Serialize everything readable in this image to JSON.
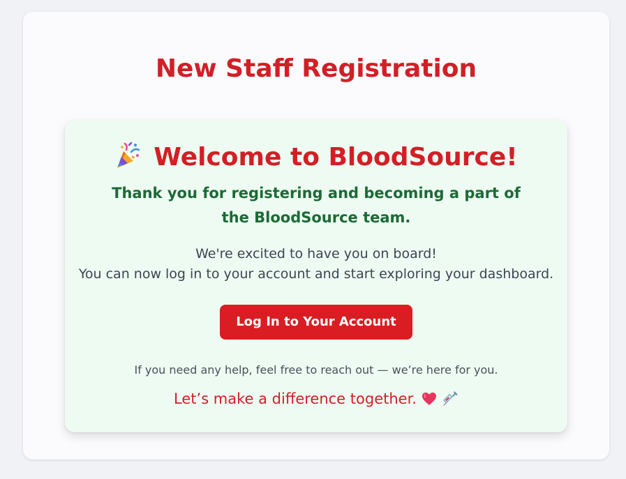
{
  "page": {
    "title": "New Staff Registration"
  },
  "welcome": {
    "icon": "party-popper-icon",
    "heading": "Welcome to BloodSource!",
    "thank_you": "Thank you for registering and becoming a part of the BloodSource team.",
    "excited_line1": "We're excited to have you on board!",
    "excited_line2": "You can now log in to your account and start exploring your dashboard.",
    "login_button_label": "Log In to Your Account",
    "help_text": "If you need any help, feel free to reach out — we’re here for you.",
    "closing_text": "Let’s make a difference together.",
    "closing_icons": [
      "heart-icon",
      "syringe-icon"
    ]
  },
  "colors": {
    "page_bg": "#f1f2f6",
    "card_bg": "#fbfbfd",
    "welcome_bg": "#eefbf2",
    "accent_red": "#d21f26",
    "button_red": "#d91d23",
    "green_text": "#1b6a35",
    "body_text": "#3d4452"
  }
}
